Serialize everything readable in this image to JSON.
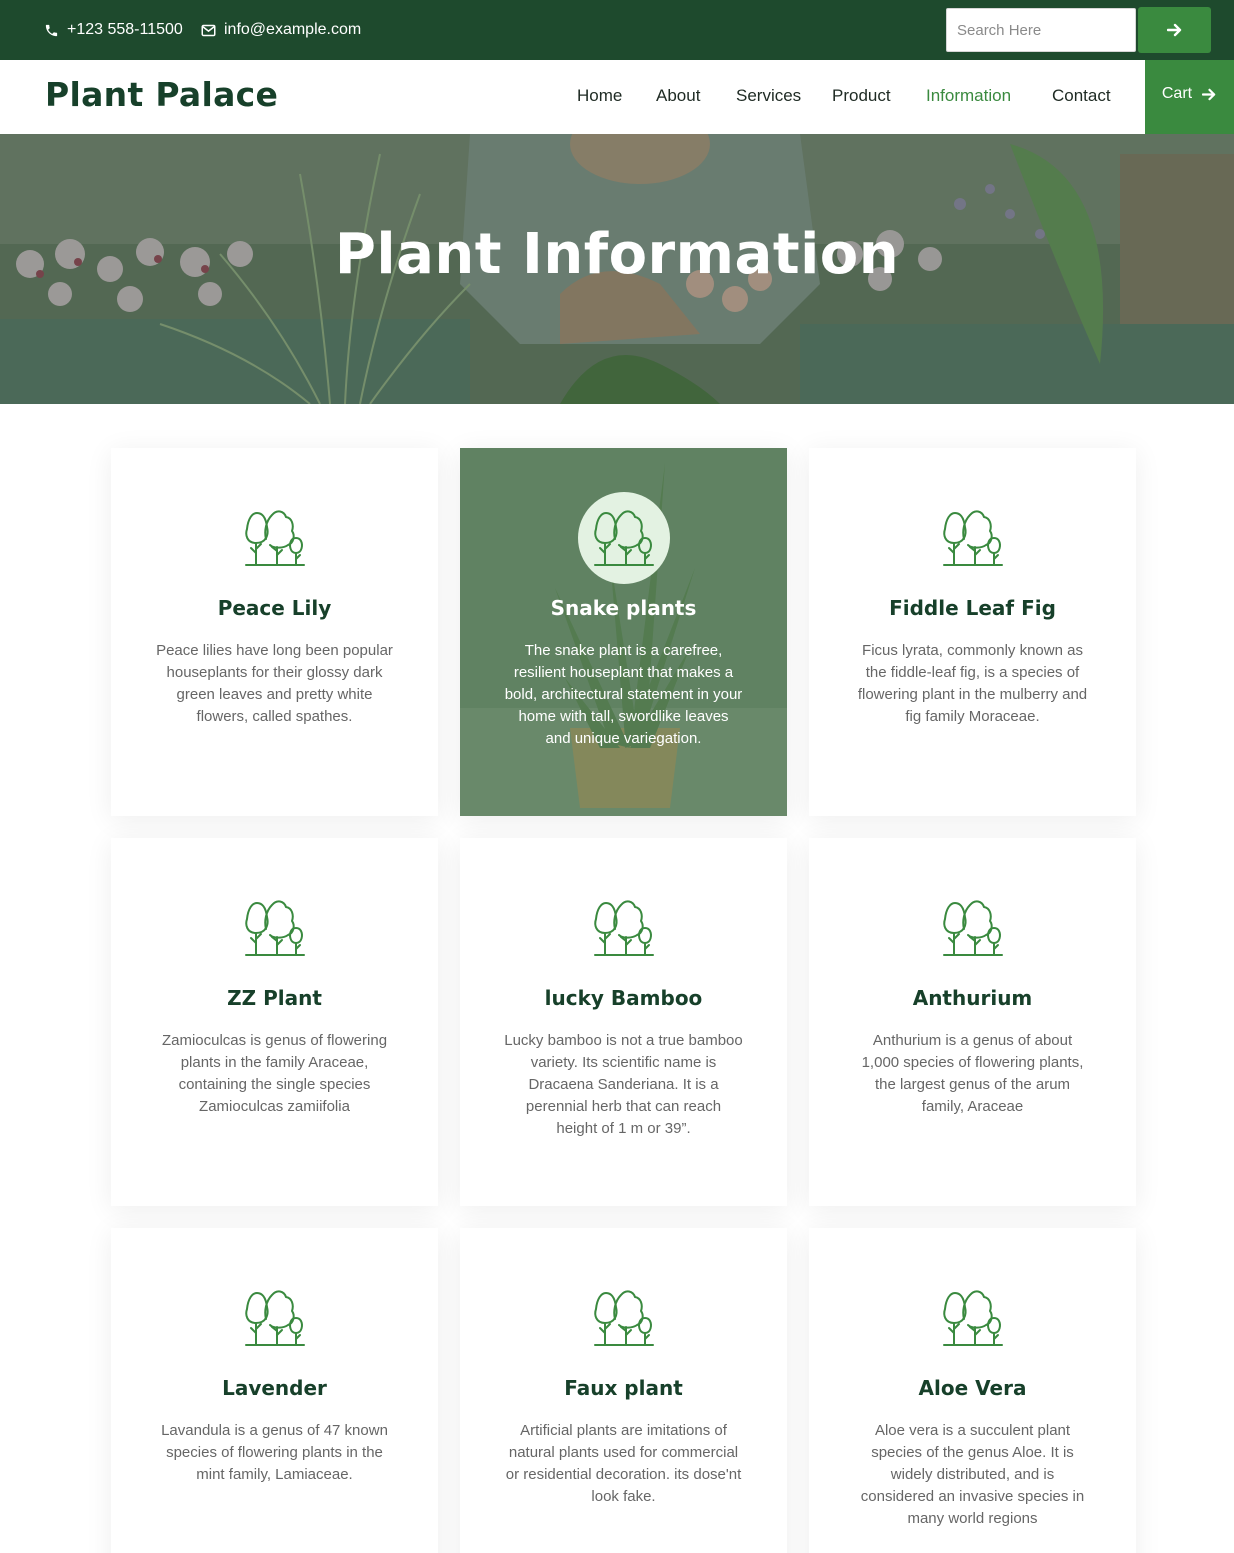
{
  "topbar": {
    "phone": "+123 558-11500",
    "email": "info@example.com",
    "search_placeholder": "Search Here",
    "search_button_icon": "arrow-right-icon"
  },
  "nav": {
    "logo": "Plant Palace",
    "links": [
      "Home",
      "About",
      "Services",
      "Product",
      "Information",
      "Contact"
    ],
    "active": "Information",
    "cart_label": "Cart"
  },
  "hero": {
    "title": "Plant Information"
  },
  "cards": [
    {
      "title": "Peace Lily",
      "text": "Peace lilies have long been popular houseplants for their glossy dark green leaves and pretty white flowers, called spathes.",
      "icon": "trees-icon"
    },
    {
      "title": "Snake plants",
      "text": "The snake plant is a carefree, resilient houseplant that makes a bold, architectural statement in your home with tall, swordlike leaves and unique variegation.",
      "icon": "trees-icon",
      "featured": true
    },
    {
      "title": "Fiddle Leaf Fig",
      "text": "Ficus lyrata, commonly known as the fiddle-leaf fig, is a species of flowering plant in the mulberry and fig family Moraceae.",
      "icon": "trees-icon"
    },
    {
      "title": "ZZ Plant",
      "text": "Zamioculcas is genus of flowering plants in the family Araceae, containing the single species Zamioculcas zamiifolia",
      "icon": "trees-icon"
    },
    {
      "title": "lucky Bamboo",
      "text": "Lucky bamboo is not a true bamboo variety. Its scientific name is Dracaena Sanderiana. It is a perennial herb that can reach height of 1 m or 39”.",
      "icon": "trees-icon"
    },
    {
      "title": "Anthurium",
      "text": "Anthurium is a genus of about 1,000 species of flowering plants, the largest genus of the arum family, Araceae",
      "icon": "trees-icon"
    },
    {
      "title": "Lavender",
      "text": "Lavandula is a genus of 47 known species of flowering plants in the mint family, Lamiaceae.",
      "icon": "trees-icon"
    },
    {
      "title": "Faux plant",
      "text": "Artificial plants are imitations of natural plants used for commercial or residential decoration. its dose'nt look fake.",
      "icon": "trees-icon"
    },
    {
      "title": "Aloe Vera",
      "text": "Aloe vera is a succulent plant species of the genus Aloe. It is widely distributed, and is considered an invasive species in many world regions",
      "icon": "trees-icon"
    }
  ],
  "colors": {
    "topbar": "#1e4a2d",
    "accent": "#3a8a3f",
    "heading": "#17402a",
    "body_text": "#666666"
  }
}
